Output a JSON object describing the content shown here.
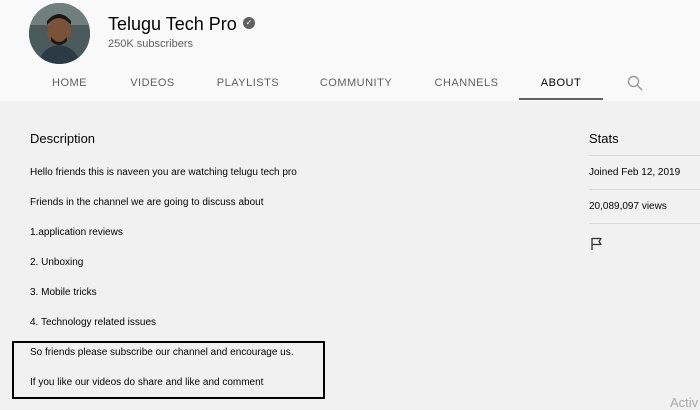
{
  "channel": {
    "name": "Telugu Tech Pro",
    "subscribers": "250K subscribers"
  },
  "tabs": [
    "HOME",
    "VIDEOS",
    "PLAYLISTS",
    "COMMUNITY",
    "CHANNELS",
    "ABOUT"
  ],
  "description": {
    "title": "Description",
    "lines": [
      "Hello friends this is naveen you are watching telugu tech pro",
      "Friends in the channel we are going to discuss about",
      "1.application reviews",
      "2. Unboxing",
      "3. Mobile tricks",
      "4. Technology related issues",
      "So friends please subscribe our channel and encourage us.",
      "If you like our videos do share and like and comment"
    ]
  },
  "stats": {
    "title": "Stats",
    "joined": "Joined Feb 12, 2019",
    "views": "20,089,097 views"
  },
  "watermark": "Activ"
}
